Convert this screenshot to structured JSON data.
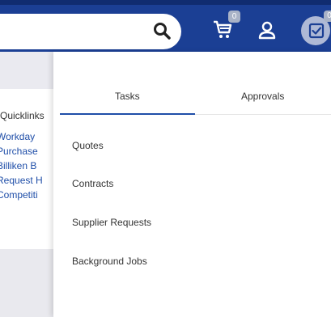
{
  "header": {
    "cart_badge": "0",
    "tasks_badge": "0",
    "colors": {
      "bar": "#1b3f94",
      "badge": "#a9b3c7",
      "link": "#1f4ea8"
    }
  },
  "background_page": {
    "quicklinks_title": "Quicklinks",
    "links": [
      "Workday",
      "Purchase",
      "Billiken B",
      "Request H",
      "Competiti"
    ]
  },
  "tasks_panel": {
    "tabs": [
      {
        "label": "Tasks",
        "active": true
      },
      {
        "label": "Approvals",
        "active": false
      }
    ],
    "items": [
      "Quotes",
      "Contracts",
      "Supplier Requests",
      "Background Jobs"
    ]
  }
}
